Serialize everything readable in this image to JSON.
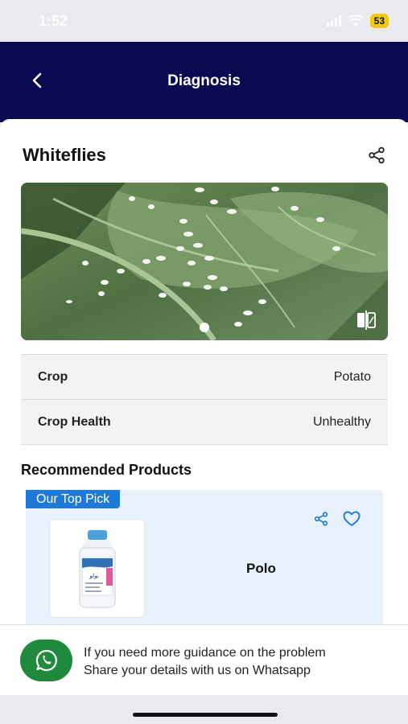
{
  "status_bar": {
    "time": "1:52",
    "battery": "53"
  },
  "header": {
    "title": "Diagnosis",
    "back_icon": "chevron-left-icon"
  },
  "diagnosis": {
    "pest_name": "Whiteflies",
    "share_icon": "share-icon",
    "image_compare_icon": "compare-icon"
  },
  "info": [
    {
      "label": "Crop",
      "value": "Potato"
    },
    {
      "label": "Crop Health",
      "value": "Unhealthy"
    }
  ],
  "recommended": {
    "title": "Recommended Products",
    "product": {
      "badge": "Our Top Pick",
      "name": "Polo",
      "bottle_label": "بولو"
    }
  },
  "whatsapp": {
    "line1": "If you need more guidance on the problem",
    "line2": "Share your details with us on Whatsapp"
  },
  "colors": {
    "header_bg": "#0a0a52",
    "accent": "#1e7ad6",
    "whatsapp": "#1f8a3b",
    "product_bg": "#e7f1fc"
  }
}
